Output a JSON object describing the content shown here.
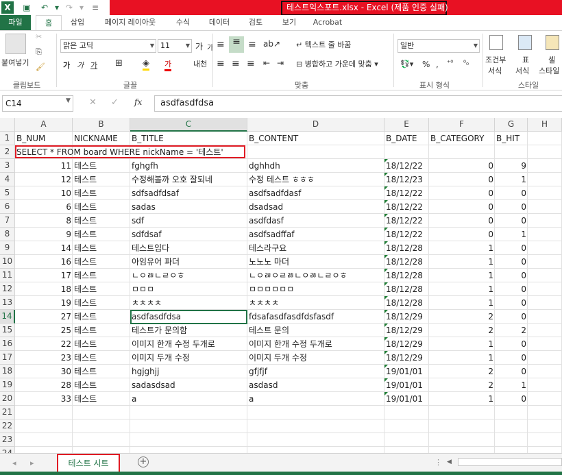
{
  "window": {
    "title": "테스트익스포트.xlsx -  Excel (제품 인증 실패)"
  },
  "ribbon_tabs": [
    "파일",
    "홈",
    "삽입",
    "페이지 레이아웃",
    "수식",
    "데이터",
    "검토",
    "보기",
    "Acrobat"
  ],
  "ribbon": {
    "paste": "붙여넣기",
    "clipboard": "클립보드",
    "font_name": "맑은 고딕",
    "font_size": "11",
    "font": "글꼴",
    "wrap_text": "텍스트 줄 바꿈",
    "merge_center": "병합하고 가운데 맞춤",
    "alignment": "맞춤",
    "number_format": "일반",
    "number": "표시 형식",
    "cond_format": "조건부",
    "cond_format2": "서식",
    "table": "표",
    "table2": "서식",
    "cell_style": "셀",
    "cell_style2": "스타일",
    "styles": "스타일",
    "grow_font": "가",
    "shrink_font": "가",
    "bold": "가",
    "italic": "가",
    "underline": "가",
    "percent": "%"
  },
  "formula_bar": {
    "cell_ref": "C14",
    "fx": "fx",
    "content": "asdfasdfdsa"
  },
  "columns": [
    "A",
    "B",
    "C",
    "D",
    "E",
    "F",
    "G",
    "H"
  ],
  "header_row": [
    "B_NUM",
    "NICKNAME",
    "B_TITLE",
    "B_CONTENT",
    "B_DATE",
    "B_CATEGORY",
    "B_HIT"
  ],
  "sql_row": "SELECT * FROM board WHERE nickName = '테스트'",
  "rows": [
    [
      "11",
      "테스트",
      "fghgfh",
      "dghhdh",
      "18/12/22",
      "0",
      "9"
    ],
    [
      "12",
      "테스트",
      "수정해볼까 오호 잘되네",
      "수정 테스트 ㅎㅎㅎ",
      "18/12/23",
      "0",
      "1"
    ],
    [
      "10",
      "테스트",
      "sdfsadfdsaf",
      "asdfsadfdasf",
      "18/12/22",
      "0",
      "0"
    ],
    [
      "6",
      "테스트",
      "sadas",
      "dsadsad",
      "18/12/22",
      "0",
      "0"
    ],
    [
      "8",
      "테스트",
      "sdf",
      "asdfdasf",
      "18/12/22",
      "0",
      "0"
    ],
    [
      "9",
      "테스트",
      "sdfdsaf",
      "asdfsadffaf",
      "18/12/22",
      "0",
      "1"
    ],
    [
      "14",
      "테스트",
      "테스트임다",
      "테스라구요",
      "18/12/28",
      "1",
      "0"
    ],
    [
      "16",
      "테스트",
      "아임유어 파더",
      "노노노 마더",
      "18/12/28",
      "1",
      "0"
    ],
    [
      "17",
      "테스트",
      "ㄴㅇㅀㄴㄹㅇㅎ",
      "ㄴㅇㅀㅇㄹㅀㄴㅇㅀㄴㄹㅇㅎ",
      "18/12/28",
      "1",
      "0"
    ],
    [
      "18",
      "테스트",
      "ㅁㅁㅁ",
      "ㅁㅁㅁㅁㅁㅁ",
      "18/12/28",
      "1",
      "0"
    ],
    [
      "19",
      "테스트",
      "ㅊㅊㅊㅊ",
      "ㅊㅊㅊㅊ",
      "18/12/28",
      "1",
      "0"
    ],
    [
      "27",
      "테스트",
      "asdfasdfdsa",
      "fdsafasdfasdfdsfasdf",
      "18/12/29",
      "2",
      "0"
    ],
    [
      "25",
      "테스트",
      "테스트가 문의함",
      "테스트 문의",
      "18/12/29",
      "2",
      "2"
    ],
    [
      "22",
      "테스트",
      "이미지 한개 수정 두개로",
      "이미지 한개 수정 두개로",
      "18/12/29",
      "1",
      "0"
    ],
    [
      "23",
      "테스트",
      "이미지 두개 수정",
      "이미지 두개 수정",
      "18/12/29",
      "1",
      "0"
    ],
    [
      "30",
      "테스트",
      "hgjghjj",
      "gfjfjf",
      "19/01/01",
      "2",
      "0"
    ],
    [
      "28",
      "테스트",
      "sadasdsad",
      "asdasd",
      "19/01/01",
      "2",
      "1"
    ],
    [
      "33",
      "테스트",
      "a",
      "a",
      "19/01/01",
      "1",
      "0"
    ]
  ],
  "row_numbers": [
    "1",
    "2",
    "3",
    "4",
    "5",
    "6",
    "7",
    "8",
    "9",
    "10",
    "11",
    "12",
    "13",
    "14",
    "15",
    "16",
    "17",
    "18",
    "19",
    "20",
    "21",
    "22",
    "23",
    "24"
  ],
  "sheet_tab": "테스트 시트",
  "accent": "#217346",
  "highlight": "#e01b24"
}
